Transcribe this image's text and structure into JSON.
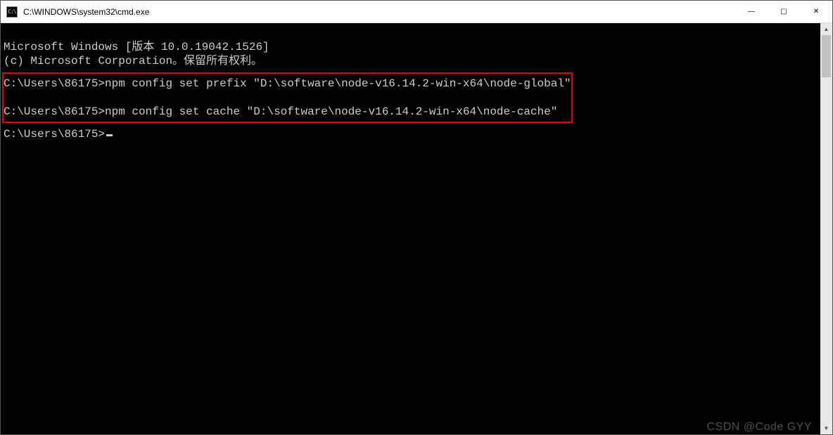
{
  "window": {
    "title": "C:\\WINDOWS\\system32\\cmd.exe",
    "icon_label": "CMD"
  },
  "controls": {
    "minimize": "—",
    "maximize": "▢",
    "close": "✕"
  },
  "terminal": {
    "line1": "Microsoft Windows [版本 10.0.19042.1526]",
    "line2": "(c) Microsoft Corporation。保留所有权利。",
    "blank": "",
    "cmd1": "C:\\Users\\86175>npm config set prefix \"D:\\software\\node-v16.14.2-win-x64\\node-global\"",
    "cmd2": "C:\\Users\\86175>npm config set cache \"D:\\software\\node-v16.14.2-win-x64\\node-cache\"",
    "prompt": "C:\\Users\\86175>"
  },
  "scrollbar": {
    "up": "▲",
    "down": "▼"
  },
  "watermark": "CSDN @Code GYY"
}
